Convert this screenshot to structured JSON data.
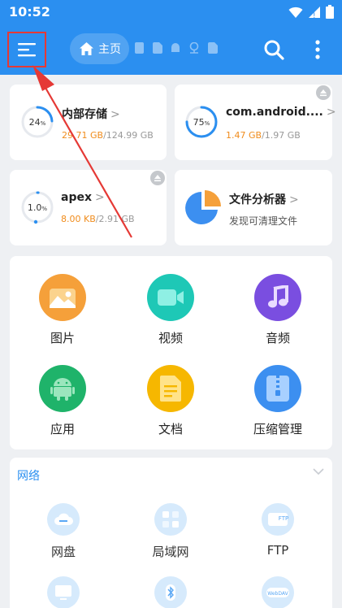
{
  "status": {
    "time": "10:52"
  },
  "appbar": {
    "home_label": "主页"
  },
  "storage": [
    {
      "title": "内部存储",
      "percent": "24",
      "used": "29.71 GB",
      "total": "/124.99 GB",
      "fraction": 0.24
    },
    {
      "title": "com.android....",
      "percent": "75",
      "used": "1.47 GB",
      "total": "/1.97 GB",
      "fraction": 0.75
    },
    {
      "title": "apex",
      "percent": "1.0",
      "used": "8.00 KB",
      "total": "/2.91 GB",
      "fraction": 0.01
    }
  ],
  "analyzer": {
    "title": "文件分析器",
    "subtitle": "发现可清理文件"
  },
  "categories": [
    {
      "label": "图片"
    },
    {
      "label": "视频"
    },
    {
      "label": "音频"
    },
    {
      "label": "应用"
    },
    {
      "label": "文档"
    },
    {
      "label": "压缩管理"
    }
  ],
  "network": {
    "title": "网络",
    "items": [
      {
        "label": "网盘"
      },
      {
        "label": "局域网"
      },
      {
        "label": "FTP"
      }
    ],
    "row2_badge": "WebDAV"
  },
  "colors": {
    "primary": "#2b8ff0",
    "orange": "#f08c1c",
    "image": "#f5a03a",
    "video": "#1ec8b6",
    "audio": "#7a4ee0",
    "app": "#1fb36a",
    "doc": "#f6b700",
    "zip": "#3c8ff0"
  }
}
